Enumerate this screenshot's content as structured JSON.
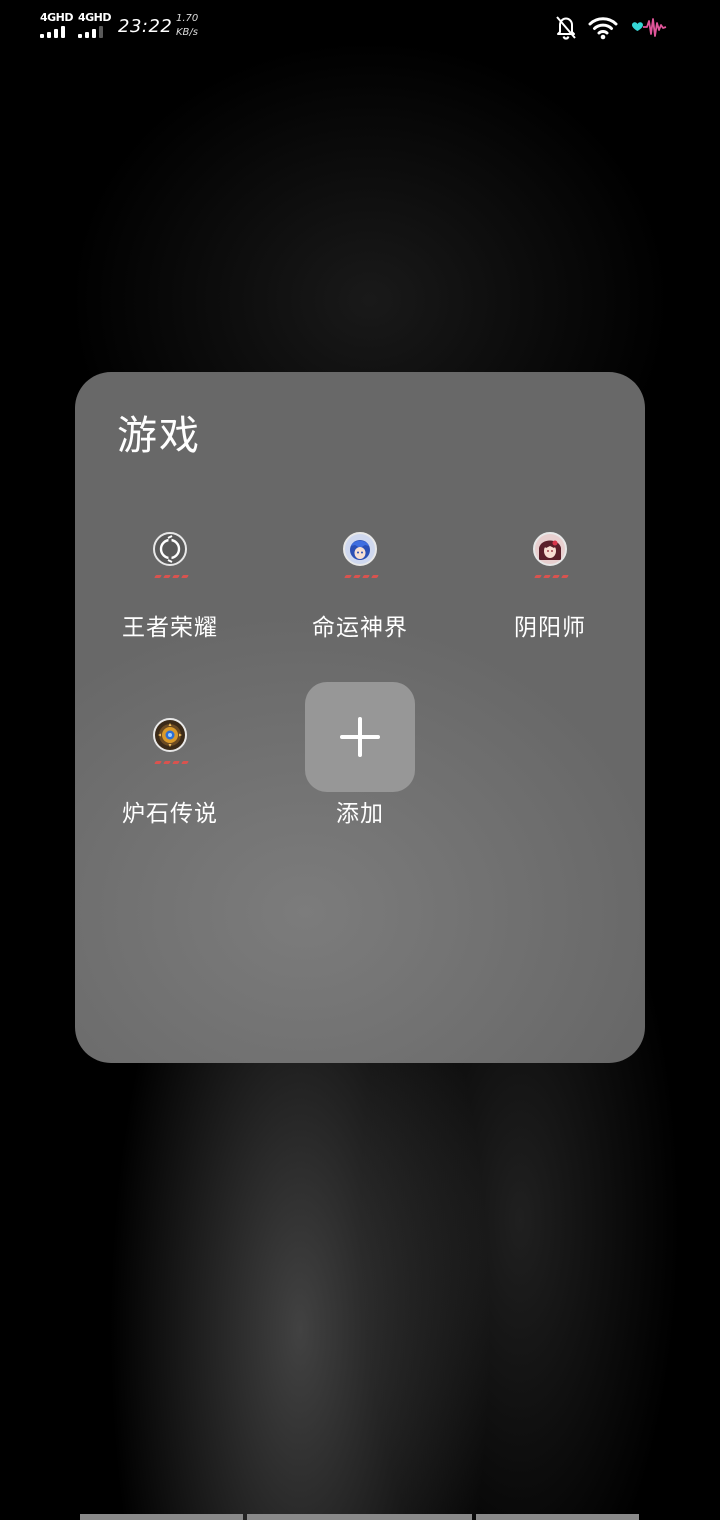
{
  "status_bar": {
    "sim1_label": "4GHD",
    "sim2_label": "4GHD",
    "sim1_bars": 4,
    "sim2_bars": 3,
    "time": "23:22",
    "net_speed_value": "1.70",
    "net_speed_unit": "KB/s",
    "icons": [
      "bell-off-icon",
      "wifi-icon",
      "heart-pulse-icon"
    ]
  },
  "folder": {
    "title": "游戏",
    "apps": [
      {
        "label": "王者荣耀",
        "icon": "honor-of-kings-icon"
      },
      {
        "label": "命运神界",
        "icon": "destiny-realm-icon"
      },
      {
        "label": "阴阳师",
        "icon": "onmyoji-icon"
      },
      {
        "label": "炉石传说",
        "icon": "hearthstone-icon"
      }
    ],
    "add_label": "添加"
  },
  "colors": {
    "folder_bg": "#686868",
    "add_tile_bg": "#979797",
    "download_dots": "#d9534f",
    "heart_accent": "#35d6d6",
    "pulse_accent": "#e0559a"
  }
}
